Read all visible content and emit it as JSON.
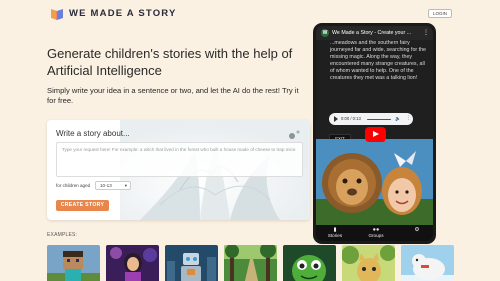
{
  "header": {
    "brand": "WE MADE A STORY",
    "login_label": "LOGIN"
  },
  "hero": {
    "headline": "Generate children's stories with the help of Artificial Intelligence",
    "subline": "Simply write your idea in a sentence or two, and let the AI do the rest! Try it for free."
  },
  "form": {
    "title": "Write a story about...",
    "placeholder": "Type your request here! For example: a witch that lived in the forest who built a house made of cheese to trap mice",
    "age_label": "for children aged",
    "age_value": "10-13",
    "create_label": "CREATE STORY"
  },
  "examples": {
    "label": "EXAMPLES:",
    "thumbnails": [
      {
        "icon": "minecraft-character-illustration"
      },
      {
        "icon": "fantasy-girl-illustration"
      },
      {
        "icon": "robot-city-illustration"
      },
      {
        "icon": "forest-path-illustration"
      },
      {
        "icon": "green-monster-illustration"
      },
      {
        "icon": "jungle-cat-illustration"
      },
      {
        "icon": "polar-bear-illustration"
      }
    ]
  },
  "phone": {
    "channel_initial": "W",
    "video_title": "We Made a Story - Create your ...",
    "story_text": "...meadows and the southern fairy journeyed far and wide, searching for the missing magic. Along the way, they encountered many strange creatures, all of whom wanted to help. One of the creatures they met was a talking lion!",
    "audio_time": "0:00 / 0:13",
    "button_label": "EXIT",
    "button_number": "1",
    "nav": [
      {
        "label": "Stories",
        "icon": "book-icon"
      },
      {
        "label": "Groups",
        "icon": "users-icon"
      },
      {
        "label": "",
        "icon": "gear-icon"
      }
    ]
  },
  "colors": {
    "page_bg": "#fbf1e3",
    "accent": "#e8864b",
    "youtube_red": "#ff0000"
  }
}
